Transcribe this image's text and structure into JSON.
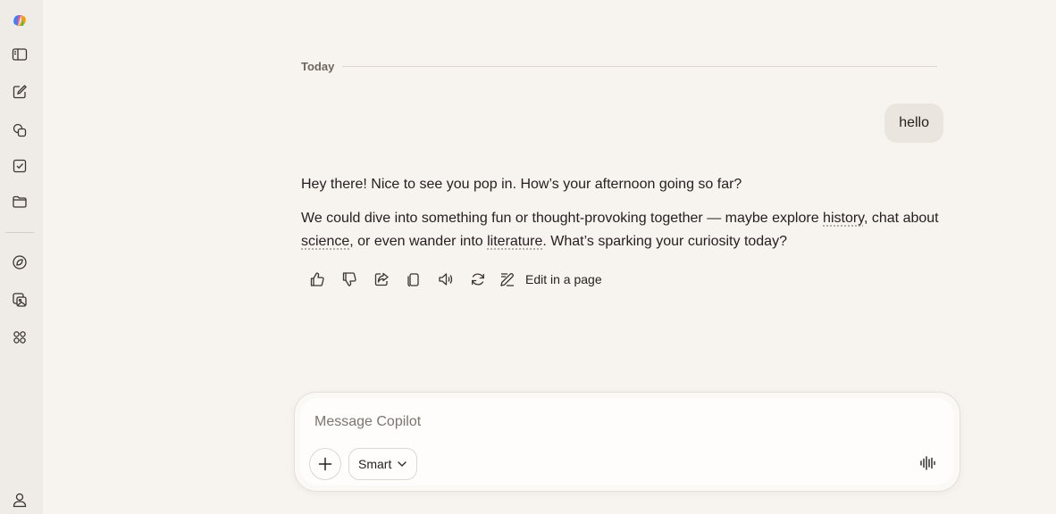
{
  "sidebar": {
    "items": [
      {
        "name": "copilot-logo-icon"
      },
      {
        "name": "toggle-sidebar-icon"
      },
      {
        "name": "new-chat-icon"
      },
      {
        "name": "copy-pages-icon"
      },
      {
        "name": "tasks-icon"
      },
      {
        "name": "folder-icon"
      },
      {
        "name": "discover-icon"
      },
      {
        "name": "image-gallery-icon"
      },
      {
        "name": "apps-icon"
      },
      {
        "name": "profile-icon"
      }
    ]
  },
  "conversation": {
    "date_label": "Today",
    "user_message": "hello",
    "reply": {
      "paragraph1": "Hey there! Nice to see you pop in. How’s your afternoon going so far?",
      "p2_part1": "We could dive into something fun or thought-provoking together — maybe explore ",
      "p2_link1": "history",
      "p2_part2": ", chat about ",
      "p2_link2": "science",
      "p2_part3": ", or even wander into ",
      "p2_link3": "literature",
      "p2_part4": ". What’s sparking your curiosity today?"
    },
    "actions": {
      "edit_label": "Edit in a page",
      "icons": [
        "thumbs-up-icon",
        "thumbs-down-icon",
        "share-icon",
        "copy-icon",
        "read-aloud-icon",
        "regenerate-icon",
        "edit-page-icon"
      ]
    }
  },
  "composer": {
    "placeholder": "Message Copilot",
    "mode_label": "Smart"
  },
  "colors": {
    "background": "#f7f3ef",
    "sidebar": "#efebe6",
    "bubble": "#ebe5df",
    "text": "#26211e"
  }
}
